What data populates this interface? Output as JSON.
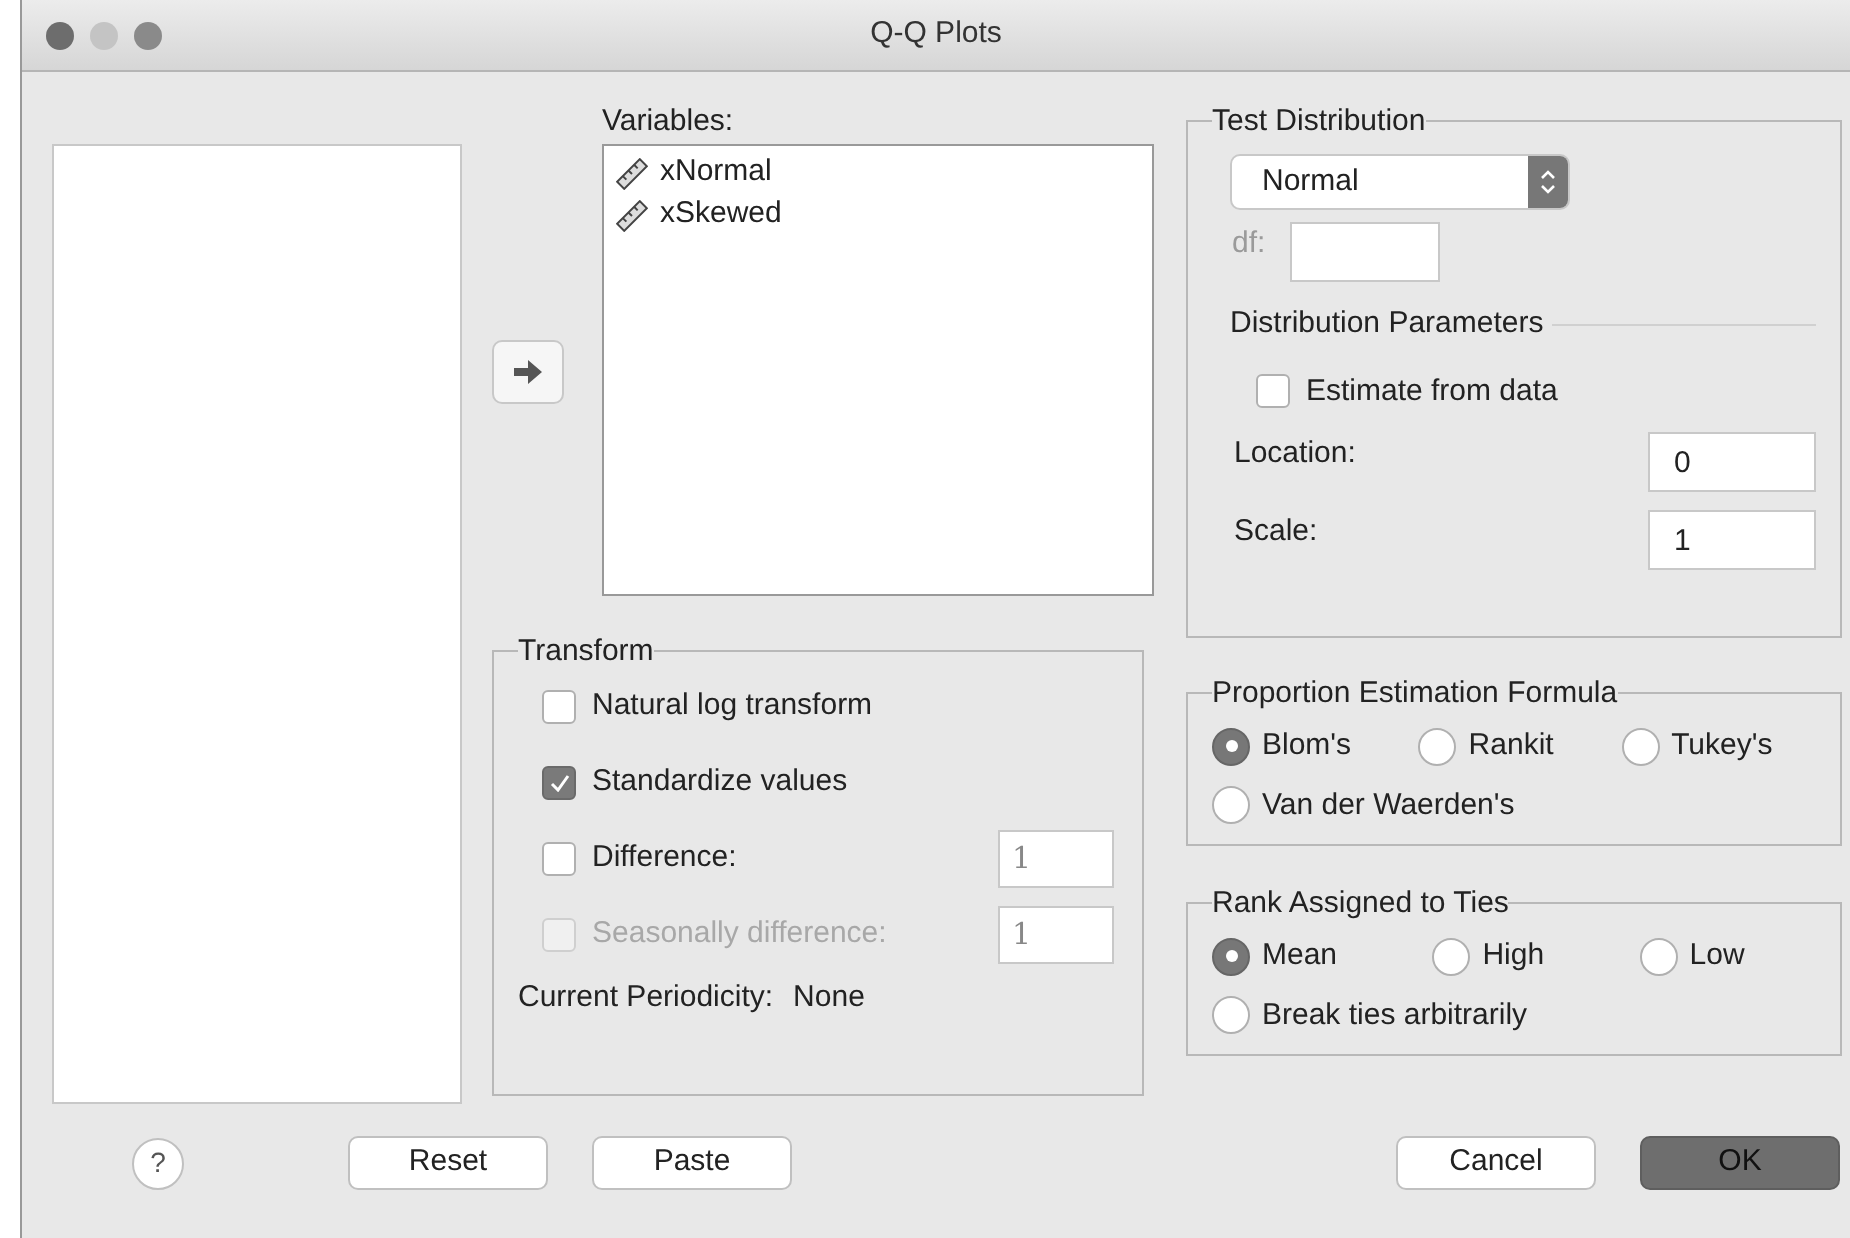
{
  "window": {
    "title": "Q-Q Plots"
  },
  "variables": {
    "label": "Variables:",
    "items": [
      {
        "name": "xNormal"
      },
      {
        "name": "xSkewed"
      }
    ]
  },
  "test_distribution": {
    "title": "Test Distribution",
    "distribution": "Normal",
    "df_label": "df:",
    "df_disabled": true,
    "parameters_title": "Distribution Parameters",
    "estimate": {
      "label": "Estimate from data",
      "checked": false
    },
    "fields": [
      {
        "label": "Location:",
        "value": "0"
      },
      {
        "label": "Scale:",
        "value": "1"
      }
    ]
  },
  "transform": {
    "title": "Transform",
    "options": [
      {
        "label": "Natural log transform",
        "checked": false,
        "disabled": false
      },
      {
        "label": "Standardize values",
        "checked": true,
        "disabled": false
      },
      {
        "label": "Difference:",
        "checked": false,
        "disabled": false,
        "value": "1"
      },
      {
        "label": "Seasonally difference:",
        "checked": false,
        "disabled": true,
        "value": "1"
      }
    ],
    "periodicity_label": "Current Periodicity:",
    "periodicity_value": "None"
  },
  "proportion_formula": {
    "title": "Proportion Estimation Formula",
    "options": [
      {
        "label": "Blom's",
        "selected": true
      },
      {
        "label": "Rankit",
        "selected": false
      },
      {
        "label": "Tukey's",
        "selected": false
      },
      {
        "label": "Van der Waerden's",
        "selected": false
      }
    ]
  },
  "rank_ties": {
    "title": "Rank Assigned to Ties",
    "options": [
      {
        "label": "Mean",
        "selected": true
      },
      {
        "label": "High",
        "selected": false
      },
      {
        "label": "Low",
        "selected": false
      },
      {
        "label": "Break ties arbitrarily",
        "selected": false
      }
    ]
  },
  "buttons_left": [
    {
      "label": "?",
      "kind": "help"
    },
    {
      "label": "Reset",
      "kind": "normal"
    },
    {
      "label": "Paste",
      "kind": "normal"
    }
  ],
  "buttons_right": [
    {
      "label": "Cancel",
      "kind": "normal"
    },
    {
      "label": "OK",
      "kind": "default"
    }
  ]
}
